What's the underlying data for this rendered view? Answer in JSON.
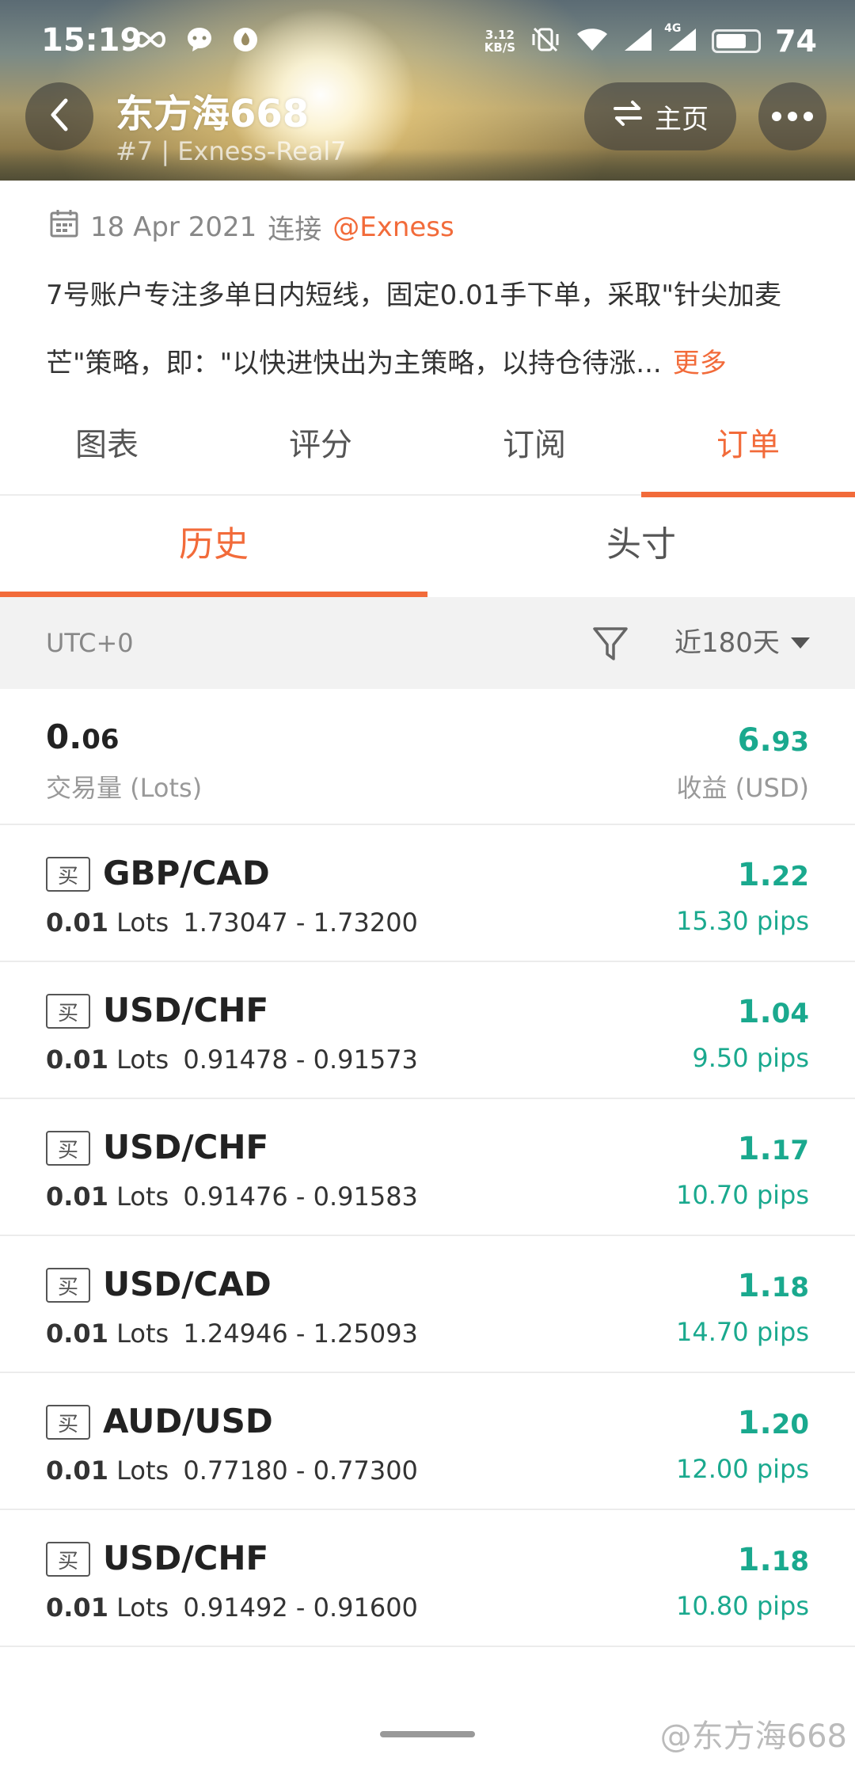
{
  "status_bar": {
    "time": "15:19",
    "left_icons": [
      "infinity-icon",
      "chat-bubble-icon",
      "app-notification-icon"
    ],
    "net_speed_value": "3.12",
    "net_speed_unit": "KB/S",
    "network_type": "4G",
    "battery": "74",
    "battery_level": 0.74
  },
  "header": {
    "title": "东方海668",
    "subtitle": "#7 | Exness-Real7",
    "home_label": "主页",
    "back_icon": "chevron-left-icon",
    "swap_icon": "swap-icon",
    "more_icon": "more-horizontal-icon"
  },
  "info": {
    "date": "18 Apr 2021",
    "connect_label": "连接",
    "broker": "@Exness",
    "description_line1": "7号账户专注多单日内短线，固定0.01手下单，采取\"针尖加麦",
    "description_line2": "芒\"策略，即：\"以快进快出为主策略，以持仓待涨...",
    "more_label": "更多"
  },
  "main_tabs": [
    {
      "label": "图表"
    },
    {
      "label": "评分"
    },
    {
      "label": "订阅"
    },
    {
      "label": "订单",
      "active": true
    }
  ],
  "sub_tabs": [
    {
      "label": "历史",
      "active": true
    },
    {
      "label": "头寸"
    }
  ],
  "filter": {
    "timezone": "UTC+0",
    "period": "近180天"
  },
  "summary": {
    "volume_main": "0.",
    "volume_small": "06",
    "volume_label": "交易量 (Lots)",
    "profit_main": "6.",
    "profit_small": "93",
    "profit_label": "收益 (USD)"
  },
  "orders": [
    {
      "side": "买",
      "pair": "GBP/CAD",
      "lots": "0.01",
      "lots_unit": "Lots",
      "prices": "1.73047 - 1.73200",
      "profit_main": "1.",
      "profit_small": "22",
      "pips": "15.30 pips"
    },
    {
      "side": "买",
      "pair": "USD/CHF",
      "lots": "0.01",
      "lots_unit": "Lots",
      "prices": "0.91478 - 0.91573",
      "profit_main": "1.",
      "profit_small": "04",
      "pips": "9.50 pips"
    },
    {
      "side": "买",
      "pair": "USD/CHF",
      "lots": "0.01",
      "lots_unit": "Lots",
      "prices": "0.91476 - 0.91583",
      "profit_main": "1.",
      "profit_small": "17",
      "pips": "10.70 pips"
    },
    {
      "side": "买",
      "pair": "USD/CAD",
      "lots": "0.01",
      "lots_unit": "Lots",
      "prices": "1.24946 - 1.25093",
      "profit_main": "1.",
      "profit_small": "18",
      "pips": "14.70 pips"
    },
    {
      "side": "买",
      "pair": "AUD/USD",
      "lots": "0.01",
      "lots_unit": "Lots",
      "prices": "0.77180 - 0.77300",
      "profit_main": "1.",
      "profit_small": "20",
      "pips": "12.00 pips"
    },
    {
      "side": "买",
      "pair": "USD/CHF",
      "lots": "0.01",
      "lots_unit": "Lots",
      "prices": "0.91492 - 0.91600",
      "profit_main": "1.",
      "profit_small": "18",
      "pips": "10.80 pips"
    }
  ],
  "watermark": "@东方海668",
  "colors": {
    "accent": "#f26b3a",
    "profit": "#1aa98e"
  }
}
